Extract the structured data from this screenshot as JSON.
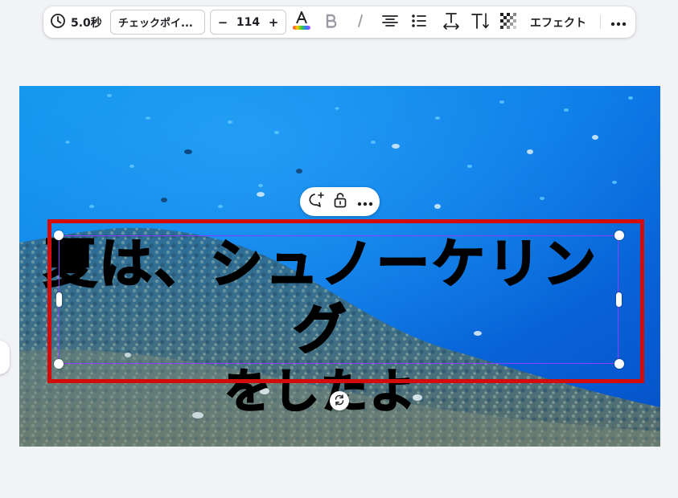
{
  "toolbar": {
    "duration": "5.0秒",
    "font_name": "チェックポイ...",
    "font_size": "114",
    "decrease": "−",
    "increase": "+",
    "effects_label": "エフェクト"
  },
  "canvas": {
    "headline_line1": "夏は、シュノーケリング",
    "headline_line2": "をしたよ"
  },
  "colors": {
    "selection": "#8b3dff",
    "highlight_box": "#d30b0b",
    "water": "#0a7fe8"
  },
  "icons": {
    "duration": "clock-icon",
    "text_color": "text-color-icon",
    "bold": "bold-icon",
    "italic": "italic-icon",
    "align": "align-center-icon",
    "list": "bullet-list-icon",
    "letter_spacing": "letter-spacing-icon",
    "line_height": "text-direction-icon",
    "transparency": "transparency-icon",
    "more": "more-icon",
    "comment": "add-comment-icon",
    "lock": "lock-icon",
    "rotate": "rotate-icon"
  }
}
